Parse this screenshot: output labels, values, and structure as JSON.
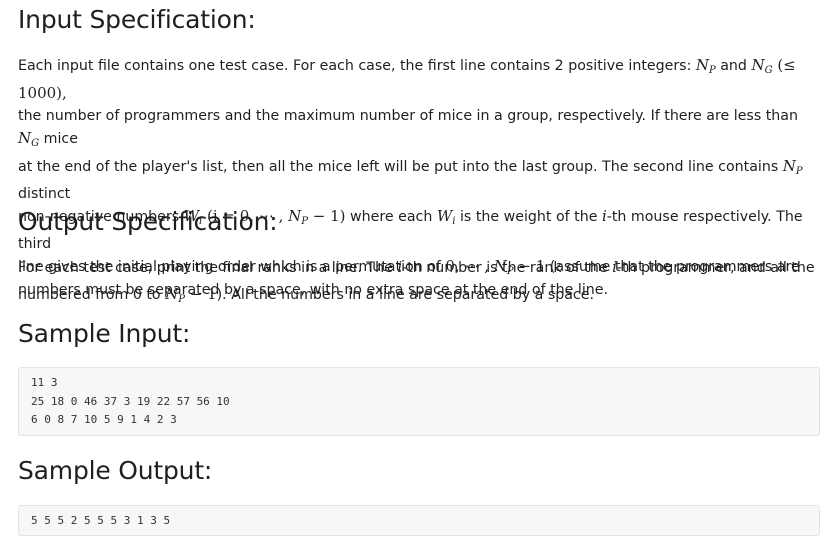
{
  "sections": {
    "input_title": "Input Specification:",
    "output_title": "Output Specification:",
    "sample_input_title": "Sample Input:",
    "sample_output_title": "Sample Output:"
  },
  "input_spec": {
    "t1": "Each input file contains one test case. For each case, the first line contains 2 positive integers: ",
    "NP": "N",
    "NP_sub": "P",
    "and": " and ",
    "NG": "N",
    "NG_sub": "G",
    "le1000": " (≤ 1000),",
    "t2": "the number of programmers and the maximum number of mice in a group, respectively. If there are less than ",
    "t2_mice": " mice",
    "t3": "at the end of the player's list, then all the mice left will be put into the last group. The second line contains ",
    "t3_distinct": " distinct",
    "t4a": "non-negative numbers ",
    "W": "W",
    "W_sub": "i",
    "range": " (i = 0, ⋯ , ",
    "range_end": " − 1)",
    "t4b": " where each ",
    "t4c": " is the weight of the ",
    "i": "i",
    "t4d": "-th mouse respectively. The third",
    "t5a": "line gives the initial playing order which is a permutation of ",
    "perm": "0, ⋯ , ",
    "perm_end": " − 1",
    "t5b": " (assume that the programmers are",
    "t6a": "numbered from 0 to ",
    "t6_end": " − 1",
    "t6b": "). All the numbers in a line are separated by a space."
  },
  "output_spec": {
    "t1": "For each test case, print the final ranks in a line. The ",
    "i": "i",
    "t2": "-th number is the rank of the ",
    "t3": "-th programmer, and all the",
    "t4": "numbers must be separated by a space, with no extra space at the end of the line."
  },
  "sample_input": {
    "lines": [
      "11 3",
      "25 18 0 46 37 3 19 22 57 56 10",
      "6 0 8 7 10 5 9 1 4 2 3"
    ]
  },
  "sample_output": {
    "lines": [
      "5 5 5 2 5 5 5 3 1 3 5"
    ]
  }
}
